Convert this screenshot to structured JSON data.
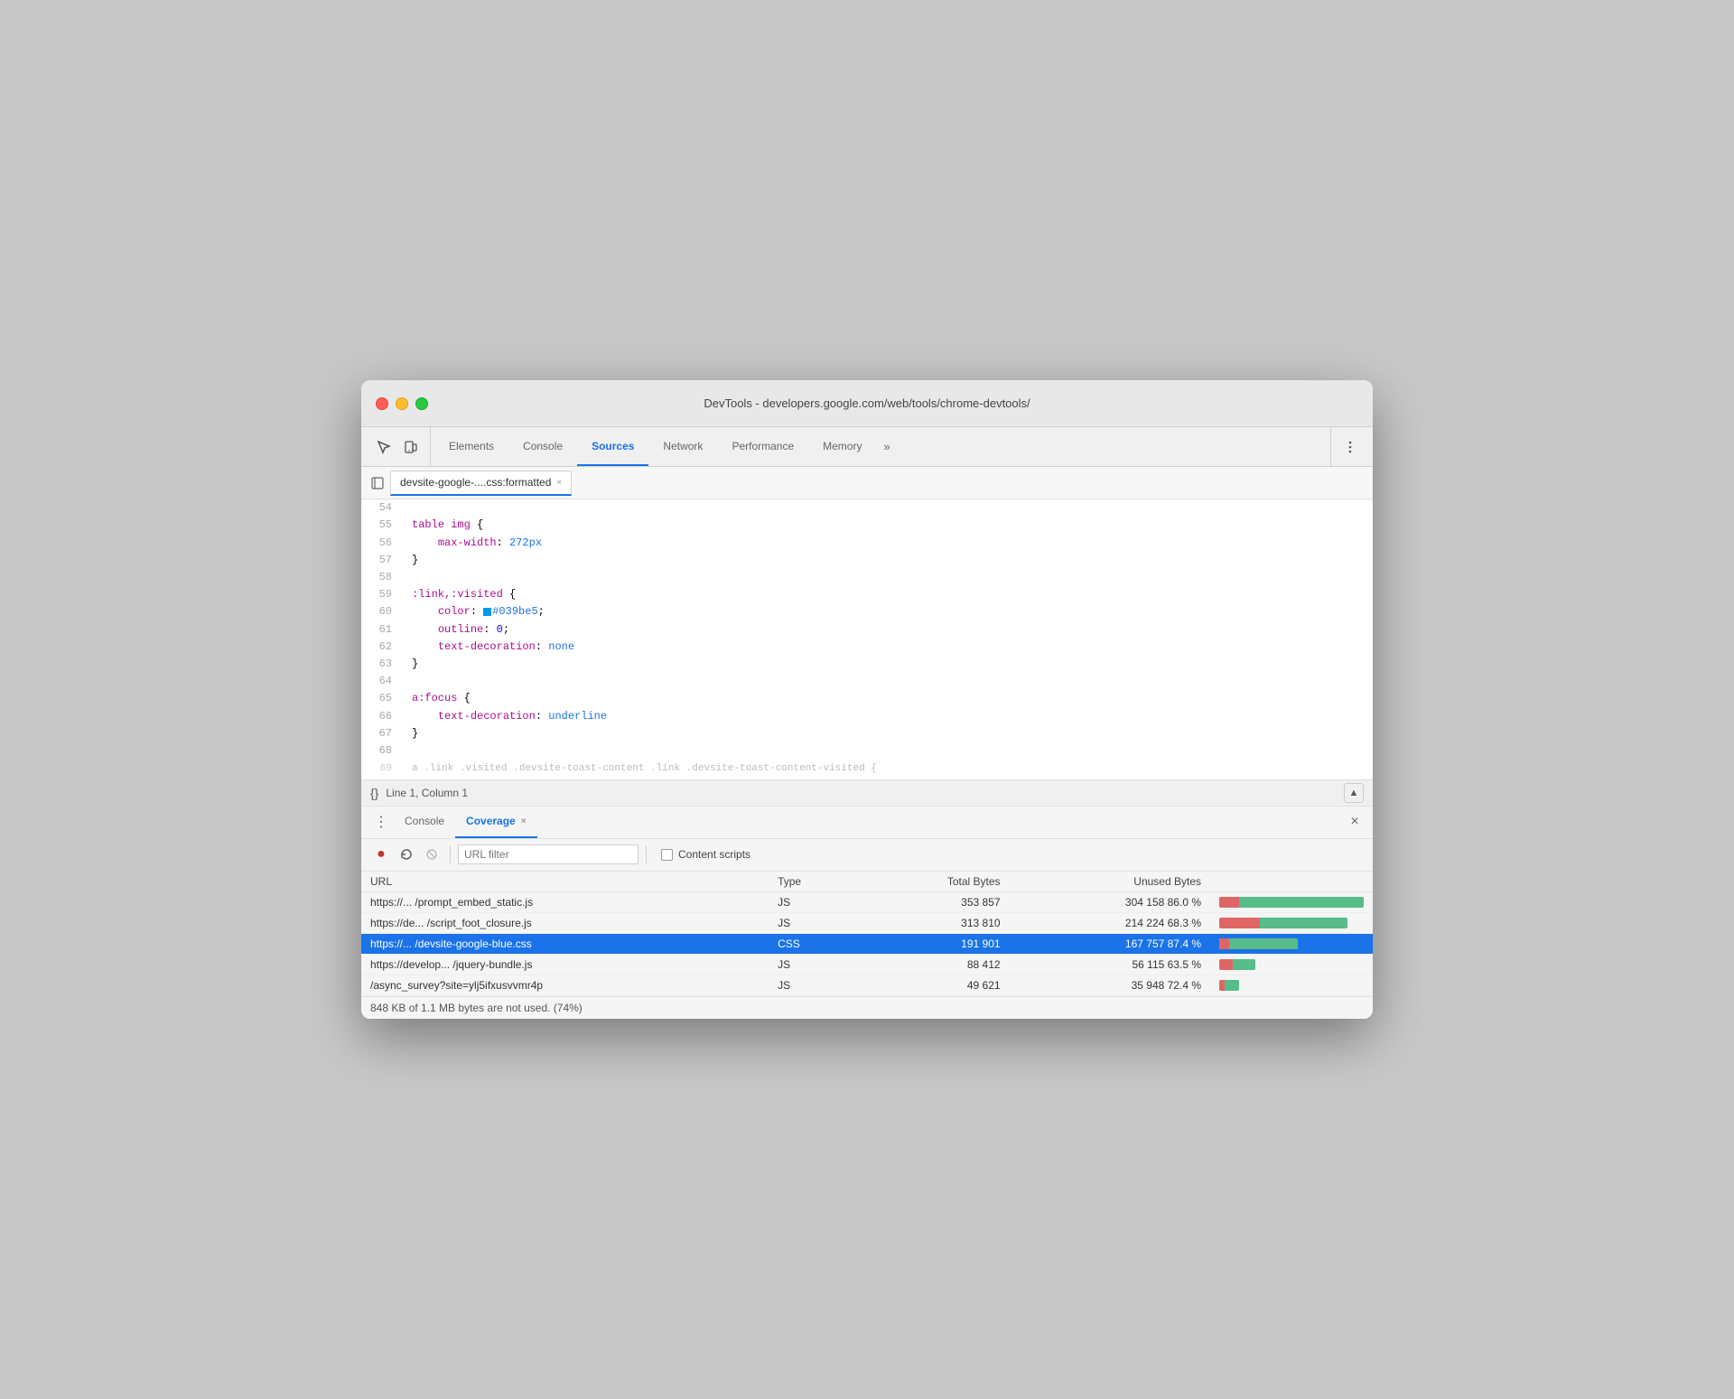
{
  "window": {
    "title": "DevTools - developers.google.com/web/tools/chrome-devtools/"
  },
  "tabs": [
    {
      "id": "elements",
      "label": "Elements",
      "active": false
    },
    {
      "id": "console",
      "label": "Console",
      "active": false
    },
    {
      "id": "sources",
      "label": "Sources",
      "active": true
    },
    {
      "id": "network",
      "label": "Network",
      "active": false
    },
    {
      "id": "performance",
      "label": "Performance",
      "active": false
    },
    {
      "id": "memory",
      "label": "Memory",
      "active": false
    }
  ],
  "file_tab": {
    "name": "devsite-google-....css:formatted",
    "close_label": "×"
  },
  "code": {
    "lines": [
      {
        "num": "54",
        "content": "",
        "type": "plain"
      },
      {
        "num": "55",
        "content": "table img {",
        "type": "plain"
      },
      {
        "num": "56",
        "content": "    max-width: 272px",
        "type": "maxwidth",
        "red": true
      },
      {
        "num": "57",
        "content": "}",
        "type": "plain"
      },
      {
        "num": "58",
        "content": "",
        "type": "plain"
      },
      {
        "num": "59",
        "content": ":link,:visited {",
        "type": "plain"
      },
      {
        "num": "60",
        "content": "    color: #039be5;",
        "type": "color",
        "red": true
      },
      {
        "num": "61",
        "content": "    outline: 0;",
        "type": "plain",
        "red": true
      },
      {
        "num": "62",
        "content": "    text-decoration: none",
        "type": "textdecor",
        "red": true
      },
      {
        "num": "63",
        "content": "}",
        "type": "plain"
      },
      {
        "num": "64",
        "content": "",
        "type": "plain"
      },
      {
        "num": "65",
        "content": "a:focus {",
        "type": "plain"
      },
      {
        "num": "66",
        "content": "    text-decoration: underline",
        "type": "textdecor2",
        "red": true
      },
      {
        "num": "67",
        "content": "}",
        "type": "plain"
      },
      {
        "num": "68",
        "content": "",
        "type": "plain"
      }
    ]
  },
  "status_bar": {
    "braces": "{}",
    "position": "Line 1, Column 1"
  },
  "bottom_panel": {
    "tabs": [
      {
        "id": "console",
        "label": "Console",
        "active": false,
        "closeable": false
      },
      {
        "id": "coverage",
        "label": "Coverage",
        "active": true,
        "closeable": true
      }
    ],
    "close_label": "×"
  },
  "coverage_toolbar": {
    "url_filter_placeholder": "URL filter",
    "content_scripts_label": "Content scripts"
  },
  "coverage_table": {
    "headers": [
      "URL",
      "Type",
      "Total Bytes",
      "Unused Bytes",
      ""
    ],
    "rows": [
      {
        "url": "https://... /prompt_embed_static.js",
        "type": "JS",
        "total_bytes": "353 857",
        "unused_bytes": "304 158",
        "unused_pct": "86.0 %",
        "used_pct": 14,
        "unused_bar_pct": 86,
        "selected": false
      },
      {
        "url": "https://de... /script_foot_closure.js",
        "type": "JS",
        "total_bytes": "313 810",
        "unused_bytes": "214 224",
        "unused_pct": "68.3 %",
        "used_pct": 32,
        "unused_bar_pct": 68,
        "selected": false
      },
      {
        "url": "https://... /devsite-google-blue.css",
        "type": "CSS",
        "total_bytes": "191 901",
        "unused_bytes": "167 757",
        "unused_pct": "87.4 %",
        "used_pct": 13,
        "unused_bar_pct": 87,
        "selected": true
      },
      {
        "url": "https://develop... /jquery-bundle.js",
        "type": "JS",
        "total_bytes": "88 412",
        "unused_bytes": "56 115",
        "unused_pct": "63.5 %",
        "used_pct": 37,
        "unused_bar_pct": 63,
        "selected": false
      },
      {
        "url": "/async_survey?site=ylj5ifxusvvmr4p",
        "type": "JS",
        "total_bytes": "49 621",
        "unused_bytes": "35 948",
        "unused_pct": "72.4 %",
        "used_pct": 28,
        "unused_bar_pct": 72,
        "selected": false
      }
    ]
  },
  "footer": {
    "text": "848 KB of 1.1 MB bytes are not used. (74%)"
  }
}
